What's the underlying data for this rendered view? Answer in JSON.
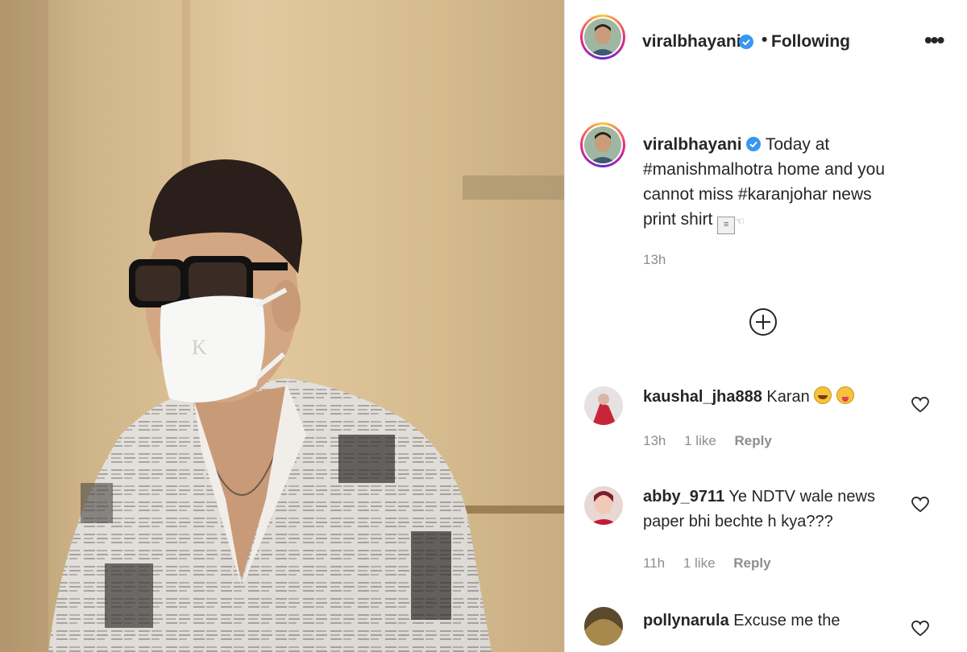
{
  "post": {
    "author": "viralbhayani",
    "follow_status": "Following",
    "separator": "•",
    "more_label": "•••",
    "caption": {
      "user": "viralbhayani",
      "text_1": " Today at ",
      "hashtag_1": "#manishmalhotra",
      "text_2": " home and you cannot miss ",
      "hashtag_2": "#karanjohar",
      "text_3": " news print shirt ",
      "newspaper_emoji": "📰",
      "hand_emoji": "👈"
    },
    "time": "13h",
    "load_more_icon": "plus-circle-icon"
  },
  "comments": [
    {
      "user": "kaushal_jha888",
      "text": " Karan ",
      "emojis": [
        "laugh",
        "tongue"
      ],
      "time": "13h",
      "likes": "1 like",
      "reply": "Reply"
    },
    {
      "user": "abby_9711",
      "text": " Ye NDTV wale news paper bhi bechte h kya???",
      "time": "11h",
      "likes": "1 like",
      "reply": "Reply"
    },
    {
      "user": "pollynarula",
      "text": " Excuse me the"
    }
  ],
  "colors": {
    "text": "#262626",
    "muted": "#8e8e8e",
    "verified": "#3897f0",
    "wall": "#d8be93"
  }
}
